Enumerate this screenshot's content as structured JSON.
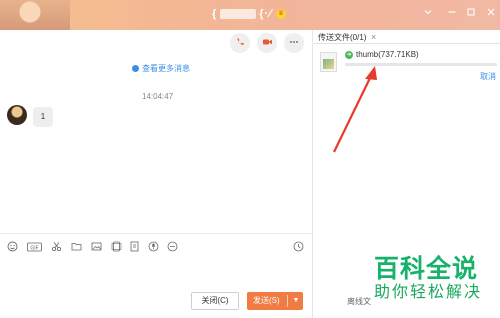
{
  "titlebar": {
    "name_left": "{",
    "name_right": "{·∕",
    "crown_icon": "crown-icon",
    "buttons": [
      "chevron-down-icon",
      "minimize-icon",
      "maximize-icon",
      "close-icon"
    ]
  },
  "chat": {
    "more_messages": "查看更多消息",
    "timestamp": "14:04:47",
    "message": "1",
    "actions": [
      "phone-icon",
      "video-icon",
      "more-icon"
    ],
    "toolbar_icons": [
      "emoji-icon",
      "gif-icon",
      "scissors-icon",
      "folder-icon",
      "image-icon",
      "screen-icon",
      "file-icon",
      "mic-icon",
      "block-icon"
    ],
    "history_icon": "clock-icon",
    "close_label": "关闭(C)",
    "send_label": "发送(S)"
  },
  "transfer": {
    "title": "传送文件(0/1)",
    "close": "×",
    "file_name": "thumb(737.71KB)",
    "cancel": "取消",
    "progress": 0.0,
    "partial_text": "离线文"
  },
  "watermark": {
    "line1": "百科全说",
    "line2": "助你轻松解决"
  },
  "colors": {
    "accent": "#3a8ee6",
    "send": "#f07c44",
    "arrow": "#e53b2c",
    "watermark": "#15b26a"
  }
}
